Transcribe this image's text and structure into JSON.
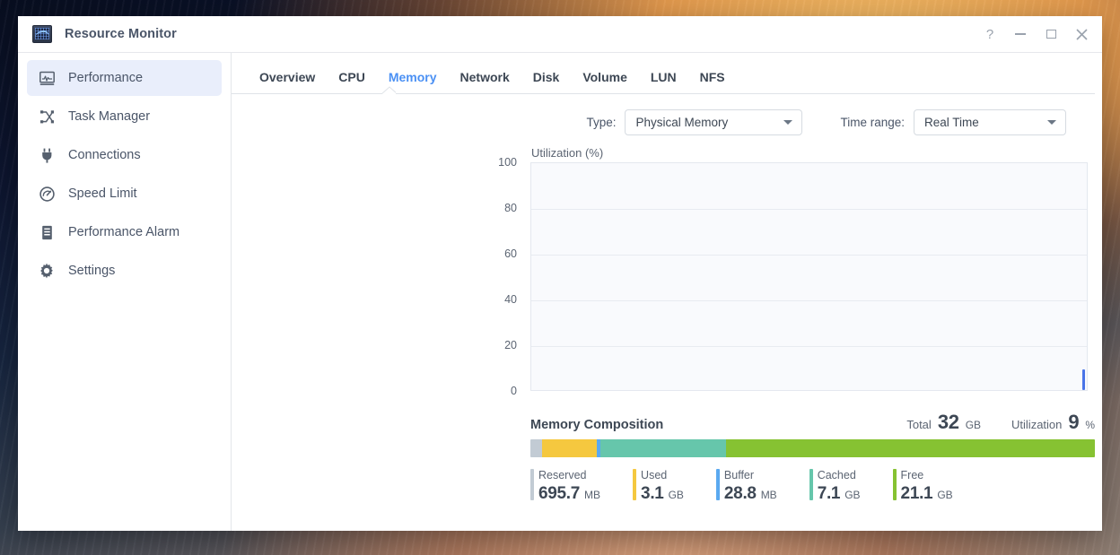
{
  "window": {
    "title": "Resource Monitor",
    "app_icon": "monitor-chart-icon",
    "controls": {
      "help": "?",
      "minimize": "minimize-icon",
      "maximize": "maximize-icon",
      "close": "close-icon"
    }
  },
  "sidebar": {
    "items": [
      {
        "label": "Performance",
        "icon": "performance-chart-icon",
        "active": true
      },
      {
        "label": "Task Manager",
        "icon": "task-manager-icon",
        "active": false
      },
      {
        "label": "Connections",
        "icon": "plug-icon",
        "active": false
      },
      {
        "label": "Speed Limit",
        "icon": "gauge-icon",
        "active": false
      },
      {
        "label": "Performance Alarm",
        "icon": "document-list-icon",
        "active": false
      },
      {
        "label": "Settings",
        "icon": "gear-icon",
        "active": false
      }
    ]
  },
  "tabs": {
    "items": [
      {
        "label": "Overview",
        "active": false
      },
      {
        "label": "CPU",
        "active": false
      },
      {
        "label": "Memory",
        "active": true
      },
      {
        "label": "Network",
        "active": false
      },
      {
        "label": "Disk",
        "active": false
      },
      {
        "label": "Volume",
        "active": false
      },
      {
        "label": "LUN",
        "active": false
      },
      {
        "label": "NFS",
        "active": false
      }
    ],
    "active_color": "#4a90f4"
  },
  "controls": {
    "type_label": "Type:",
    "type_value": "Physical Memory",
    "time_range_label": "Time range:",
    "time_range_value": "Real Time"
  },
  "chart_data": {
    "type": "line",
    "title": "Utilization (%)",
    "xlabel": "",
    "ylabel": "Utilization (%)",
    "ylim": [
      0,
      100
    ],
    "yticks": [
      0,
      20,
      40,
      60,
      80,
      100
    ],
    "ytick_labels": [
      "0",
      "20",
      "40",
      "60",
      "80",
      "100"
    ],
    "grid": true,
    "legend_position": "none",
    "series": [
      {
        "name": "Utilization",
        "color": "#4a74e8",
        "values": [
          9
        ]
      }
    ],
    "annotations": [
      {
        "text": "live data marker at right edge, value 9%",
        "x": "right",
        "y": 9
      }
    ]
  },
  "composition": {
    "title": "Memory Composition",
    "total_key": "Total",
    "total_value": "32",
    "total_unit": "GB",
    "utilization_key": "Utilization",
    "utilization_value": "9",
    "utilization_unit": "%",
    "segments": [
      {
        "name": "Reserved",
        "color": "#c2cbd4",
        "percent": 2.1
      },
      {
        "name": "Used",
        "color": "#f5c83f",
        "percent": 9.7
      },
      {
        "name": "Buffer",
        "color": "#5aa9f0",
        "percent": 0.6
      },
      {
        "name": "Cached",
        "color": "#66c6ab",
        "percent": 22.2
      },
      {
        "name": "Free",
        "color": "#86c232",
        "percent": 65.4
      }
    ],
    "legend": [
      {
        "name": "Reserved",
        "value": "695.7",
        "unit": "MB",
        "color": "#c2cbd4"
      },
      {
        "name": "Used",
        "value": "3.1",
        "unit": "GB",
        "color": "#f5c83f"
      },
      {
        "name": "Buffer",
        "value": "28.8",
        "unit": "MB",
        "color": "#5aa9f0"
      },
      {
        "name": "Cached",
        "value": "7.1",
        "unit": "GB",
        "color": "#66c6ab"
      },
      {
        "name": "Free",
        "value": "21.1",
        "unit": "GB",
        "color": "#86c232"
      }
    ]
  }
}
